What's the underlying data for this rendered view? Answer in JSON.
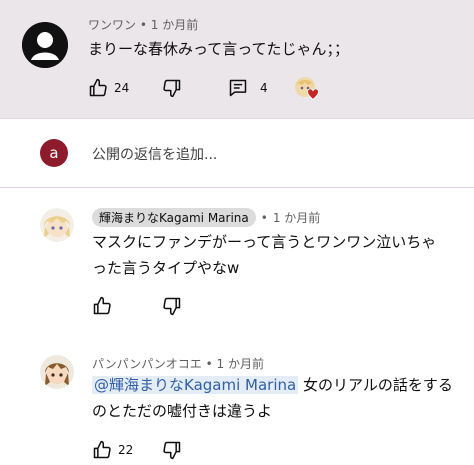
{
  "top_comment": {
    "author": "ワンワン",
    "time": "1 か月前",
    "text": "まりーな春休みって言ってたじゃん；；",
    "likes": "24",
    "replies": "4"
  },
  "reply_box": {
    "avatar_letter": "a",
    "placeholder": "公開の返信を追加..."
  },
  "reply_1": {
    "author": "輝海まりなKagami Marina",
    "time": "1 か月前",
    "text_line1": "マスクにファンデがーって言うとワンワン泣いちゃ",
    "text_line2": "った言うタイプやなw"
  },
  "reply_2": {
    "author": "パンパンパンオコエ",
    "time": "1 か月前",
    "mention": "@輝海まりなKagami Marina",
    "text_line1_rest": " 女のリアルの話をする",
    "text_line2": "のとただの嘘付きは違うよ",
    "likes": "22"
  },
  "separator": "•",
  "colors": {
    "highlight_bg": "#eae6ea",
    "heart": "#c62828",
    "reply_avatar_bg": "#8e1b2c",
    "mention": "#2f5fa8"
  }
}
